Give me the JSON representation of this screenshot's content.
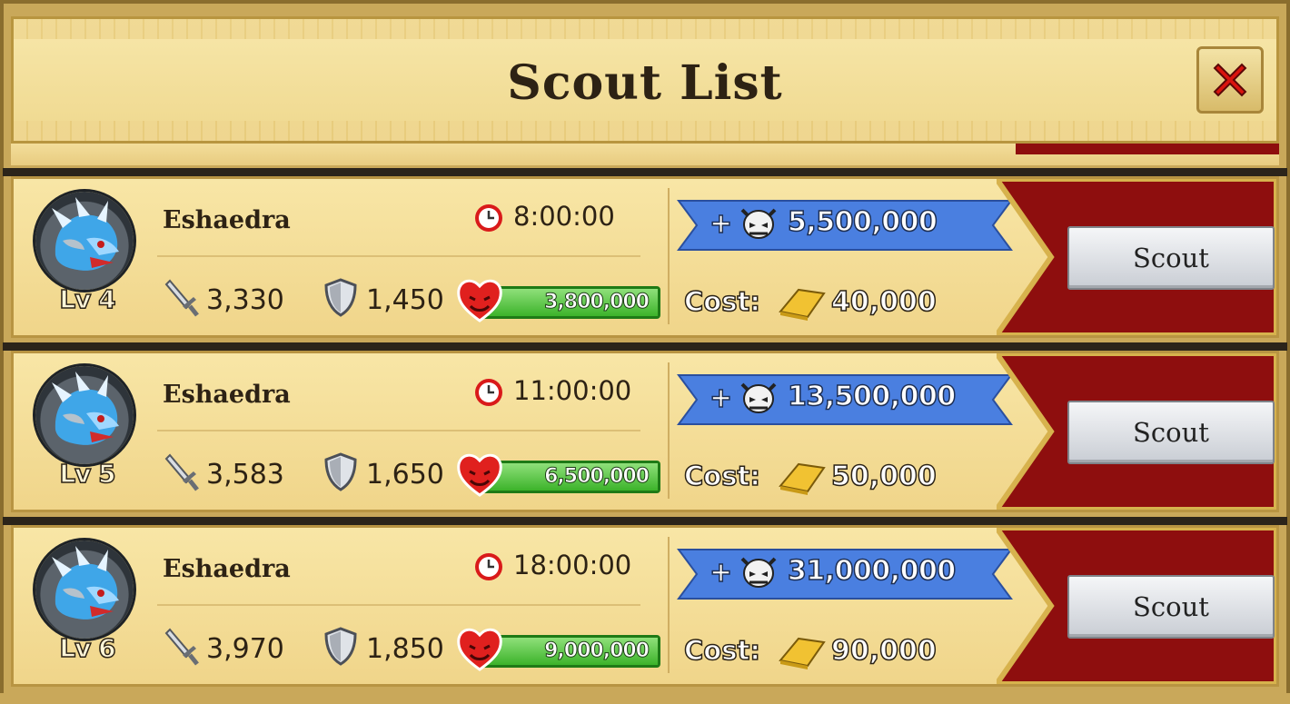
{
  "header": {
    "title": "Scout List"
  },
  "rows": [
    {
      "name": "Eshaedra",
      "level": "Lv 4",
      "timer": "8:00:00",
      "attack": "3,330",
      "defense": "1,450",
      "hp": "3,800,000",
      "reward": "5,500,000",
      "cost_label": "Cost:",
      "cost": "40,000",
      "button": "Scout",
      "reward_plus": "+"
    },
    {
      "name": "Eshaedra",
      "level": "Lv 5",
      "timer": "11:00:00",
      "attack": "3,583",
      "defense": "1,650",
      "hp": "6,500,000",
      "reward": "13,500,000",
      "cost_label": "Cost:",
      "cost": "50,000",
      "button": "Scout",
      "reward_plus": "+"
    },
    {
      "name": "Eshaedra",
      "level": "Lv 6",
      "timer": "18:00:00",
      "attack": "3,970",
      "defense": "1,850",
      "hp": "9,000,000",
      "reward": "31,000,000",
      "cost_label": "Cost:",
      "cost": "90,000",
      "button": "Scout",
      "reward_plus": "+"
    }
  ],
  "icons": {
    "close": "close-icon",
    "avatar": "dragon-avatar",
    "timer": "clock-icon",
    "attack": "sword-icon",
    "defense": "shield-icon",
    "hp": "heart-icon",
    "reward": "skull-icon",
    "cost": "gold-bar-icon"
  },
  "colors": {
    "panel": "#f0d58a",
    "banner_red": "#8e0e0e",
    "reward_blue": "#4a7fe0",
    "hp_green": "#3cb32a",
    "close_red": "#d9140e"
  }
}
